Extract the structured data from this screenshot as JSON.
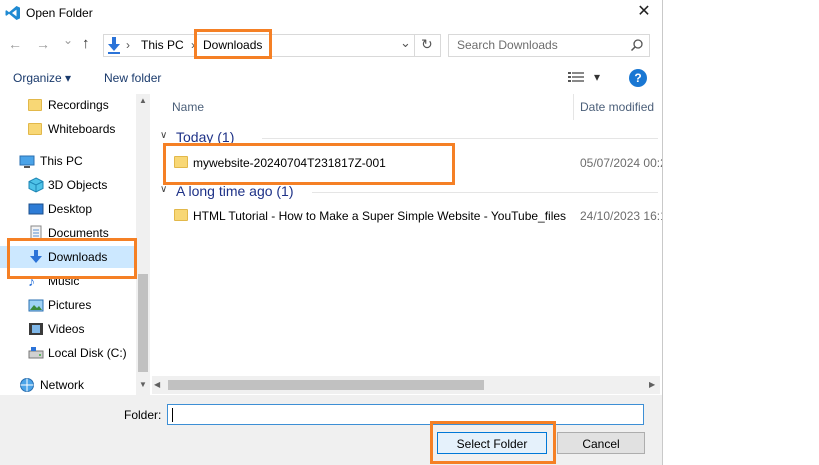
{
  "window": {
    "title": "Open Folder",
    "close": "✕"
  },
  "nav": {
    "back": "←",
    "forward": "→",
    "recent": "⌄",
    "up": "↑"
  },
  "address": {
    "crumbs": [
      "This PC",
      "Downloads"
    ],
    "separator": "›",
    "dropdown": "⌄",
    "refresh": "↻"
  },
  "search": {
    "placeholder": "Search Downloads"
  },
  "toolbar": {
    "organize": "Organize ▾",
    "new_folder": "New folder",
    "view_dropdown": "▾",
    "help": "?"
  },
  "sidebar": {
    "items": [
      {
        "label": "Recordings",
        "icon": "folder-icon"
      },
      {
        "label": "Whiteboards",
        "icon": "folder-icon"
      },
      {
        "label": "This PC",
        "icon": "computer-icon"
      },
      {
        "label": "3D Objects",
        "icon": "cube-icon"
      },
      {
        "label": "Desktop",
        "icon": "desktop-icon"
      },
      {
        "label": "Documents",
        "icon": "document-icon"
      },
      {
        "label": "Downloads",
        "icon": "download-icon",
        "selected": true
      },
      {
        "label": "Music",
        "icon": "music-icon"
      },
      {
        "label": "Pictures",
        "icon": "pictures-icon"
      },
      {
        "label": "Videos",
        "icon": "videos-icon"
      },
      {
        "label": "Local Disk (C:)",
        "icon": "drive-icon"
      },
      {
        "label": "Network",
        "icon": "network-icon"
      }
    ]
  },
  "files": {
    "columns": [
      "Name",
      "Date modified"
    ],
    "groups": [
      {
        "header": "Today (1)",
        "items": [
          {
            "name": "mywebsite-20240704T231817Z-001",
            "date": "05/07/2024 00:2"
          }
        ]
      },
      {
        "header": "A long time ago (1)",
        "items": [
          {
            "name": "HTML Tutorial - How to Make a Super Simple Website - YouTube_files",
            "date": "24/10/2023 16:1"
          }
        ]
      }
    ]
  },
  "bottom": {
    "folder_label": "Folder:",
    "folder_value": "",
    "select_button": "Select Folder",
    "cancel_button": "Cancel"
  },
  "colors": {
    "highlight": "#f58025",
    "selected_bg": "#cce8ff",
    "group_header": "#1e3287",
    "folder": "#f8d775"
  }
}
